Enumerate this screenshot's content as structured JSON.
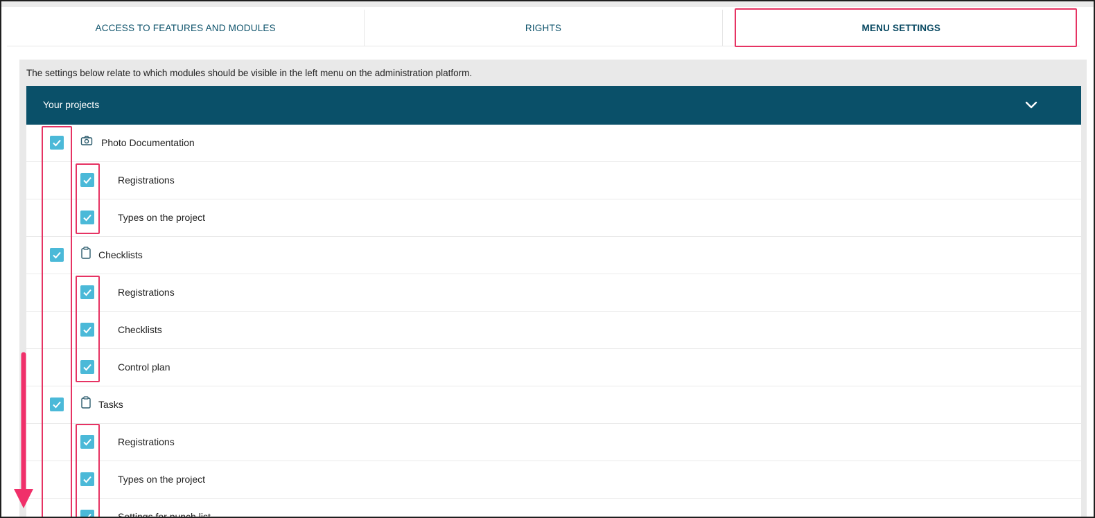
{
  "tabs": [
    {
      "label": "ACCESS TO FEATURES AND MODULES",
      "active": false
    },
    {
      "label": "RIGHTS",
      "active": false
    },
    {
      "label": "MENU SETTINGS",
      "active": true
    }
  ],
  "description": "The settings below relate to which modules should be visible in the left menu on the administration platform.",
  "section": {
    "title": "Your projects",
    "toggle_icon": "chevron-down-icon"
  },
  "items": [
    {
      "label": "Photo Documentation",
      "level": 0,
      "icon": "camera-icon",
      "checked": true
    },
    {
      "label": "Registrations",
      "level": 1,
      "checked": true
    },
    {
      "label": "Types on the project",
      "level": 1,
      "checked": true
    },
    {
      "label": "Checklists",
      "level": 0,
      "icon": "clipboard-icon",
      "checked": true
    },
    {
      "label": "Registrations",
      "level": 1,
      "checked": true
    },
    {
      "label": "Checklists",
      "level": 1,
      "checked": true
    },
    {
      "label": "Control plan",
      "level": 1,
      "checked": true
    },
    {
      "label": "Tasks",
      "level": 0,
      "icon": "clipboard-icon",
      "checked": true
    },
    {
      "label": "Registrations",
      "level": 1,
      "checked": true
    },
    {
      "label": "Types on the project",
      "level": 1,
      "checked": true
    },
    {
      "label": "Settings for punch list",
      "level": 1,
      "checked": true
    }
  ],
  "colors": {
    "accent": "#0a5069",
    "checkbox": "#4bb9d8",
    "highlight": "#e63363"
  }
}
